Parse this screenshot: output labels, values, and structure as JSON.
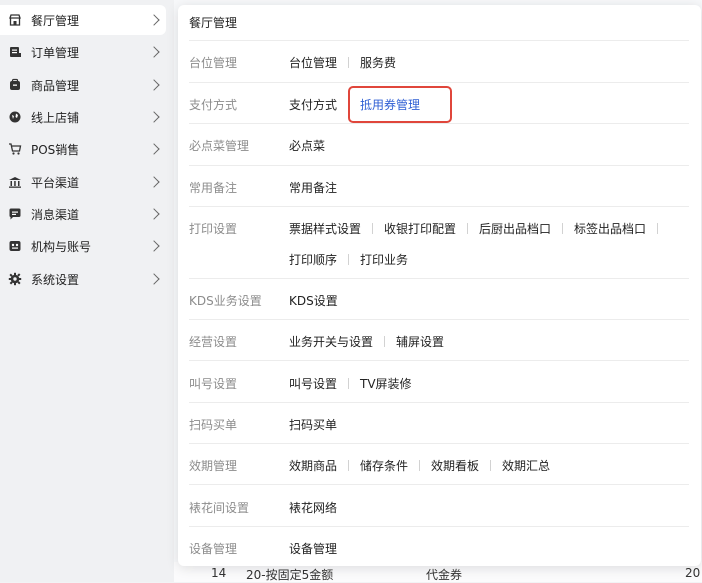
{
  "sidebar": {
    "items": [
      {
        "label": "餐厅管理",
        "icon": "store-icon",
        "active": true
      },
      {
        "label": "订单管理",
        "icon": "order-icon"
      },
      {
        "label": "商品管理",
        "icon": "goods-icon"
      },
      {
        "label": "线上店铺",
        "icon": "globe-icon"
      },
      {
        "label": "POS销售",
        "icon": "cart-icon"
      },
      {
        "label": "平台渠道",
        "icon": "bank-icon"
      },
      {
        "label": "消息渠道",
        "icon": "message-icon"
      },
      {
        "label": "机构与账号",
        "icon": "account-icon"
      },
      {
        "label": "系统设置",
        "icon": "gear-icon"
      }
    ]
  },
  "panel": {
    "title": "餐厅管理",
    "rows": [
      {
        "category": "台位管理",
        "links": [
          "台位管理",
          "服务费"
        ]
      },
      {
        "category": "支付方式",
        "links": [
          "支付方式",
          "抵用券管理"
        ]
      },
      {
        "category": "必点菜管理",
        "links": [
          "必点菜"
        ]
      },
      {
        "category": "常用备注",
        "links": [
          "常用备注"
        ]
      },
      {
        "category": "打印设置",
        "links": [
          "票据样式设置",
          "收银打印配置",
          "后厨出品档口",
          "标签出品档口"
        ],
        "links2": [
          "打印顺序",
          "打印业务"
        ]
      },
      {
        "category": "KDS业务设置",
        "links": [
          "KDS设置"
        ]
      },
      {
        "category": "经营设置",
        "links": [
          "业务开关与设置",
          "辅屏设置"
        ]
      },
      {
        "category": "叫号设置",
        "links": [
          "叫号设置",
          "TV屏装修"
        ]
      },
      {
        "category": "扫码买单",
        "links": [
          "扫码买单"
        ]
      },
      {
        "category": "效期管理",
        "links": [
          "效期商品",
          "储存条件",
          "效期看板",
          "效期汇总"
        ]
      },
      {
        "category": "裱花间设置",
        "links": [
          "裱花网络"
        ]
      },
      {
        "category": "设备管理",
        "links": [
          "设备管理"
        ]
      }
    ]
  },
  "background_row": {
    "index": "14",
    "name": "20-按固定5金额",
    "type": "代金券",
    "value": "20"
  },
  "colors": {
    "highlight_link": "#2f5fd4",
    "highlight_box": "#e0463b"
  }
}
